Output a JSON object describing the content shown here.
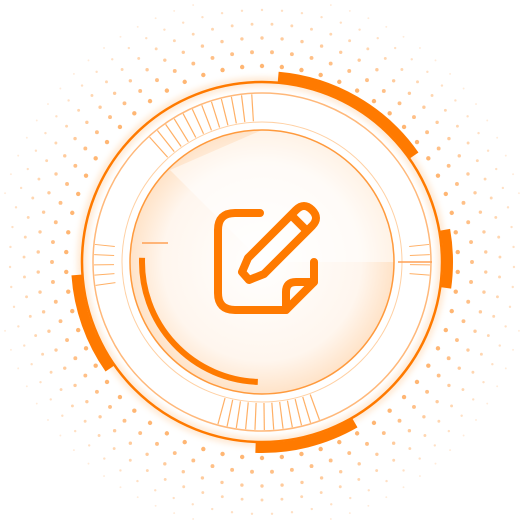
{
  "graphic": {
    "name": "hud-ring-edit-badge",
    "accent_color": "#ff7a00",
    "light_color": "#ffb066",
    "fill_color": "#fff1e3",
    "center_icon": "edit-note-icon",
    "dot_pattern": "radial-dot-halo"
  }
}
